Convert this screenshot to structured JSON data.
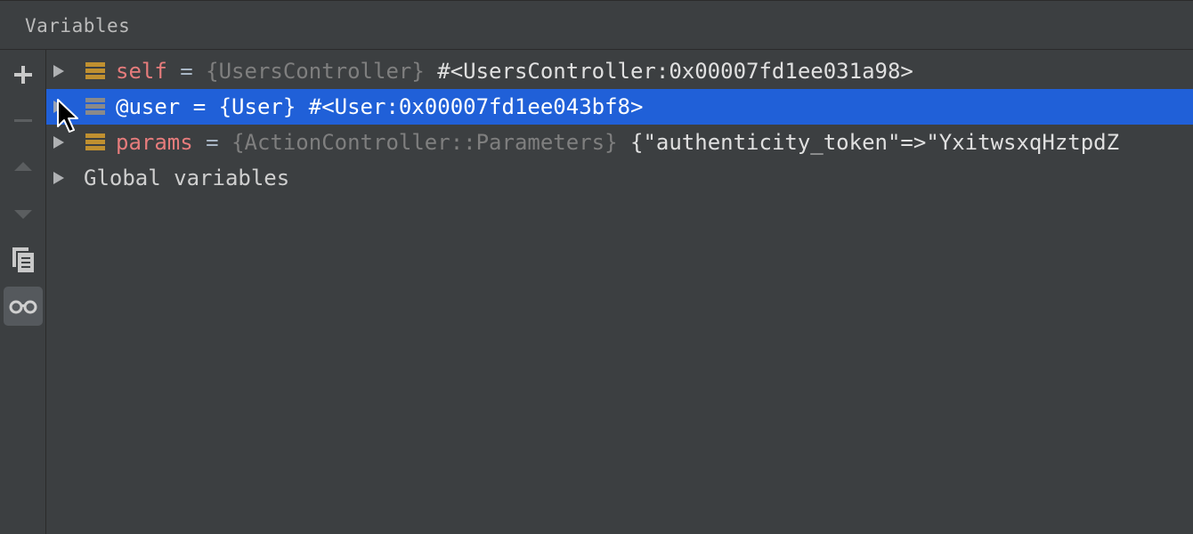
{
  "panel": {
    "title": "Variables"
  },
  "toolbar": {
    "buttons": [
      {
        "icon": "add-icon",
        "enabled": true
      },
      {
        "icon": "remove-icon",
        "enabled": false
      },
      {
        "icon": "move-up-icon",
        "enabled": false
      },
      {
        "icon": "move-down-icon",
        "enabled": false
      },
      {
        "icon": "copy-icon",
        "enabled": true
      },
      {
        "icon": "glasses-icon",
        "enabled": true,
        "active": true
      }
    ]
  },
  "variables": [
    {
      "name": "self",
      "equals": " = ",
      "type": "{UsersController}",
      "value": " #<UsersController:0x00007fd1ee031a98>",
      "selected": false
    },
    {
      "name": "@user",
      "equals": " = ",
      "type": "{User}",
      "value": " #<User:0x00007fd1ee043bf8>",
      "selected": true
    },
    {
      "name": "params",
      "equals": " = ",
      "type": "{ActionController::Parameters}",
      "value": " {\"authenticity_token\"=>\"YxitwsxqHztpdZ",
      "selected": false
    }
  ],
  "groups": [
    {
      "label": "Global variables"
    }
  ],
  "colors": {
    "background": "#3c3f41",
    "selection": "#2060d8",
    "var_name": "#e67c7c",
    "type_gray": "#7f7f7f",
    "field_icon": "#c09030"
  }
}
